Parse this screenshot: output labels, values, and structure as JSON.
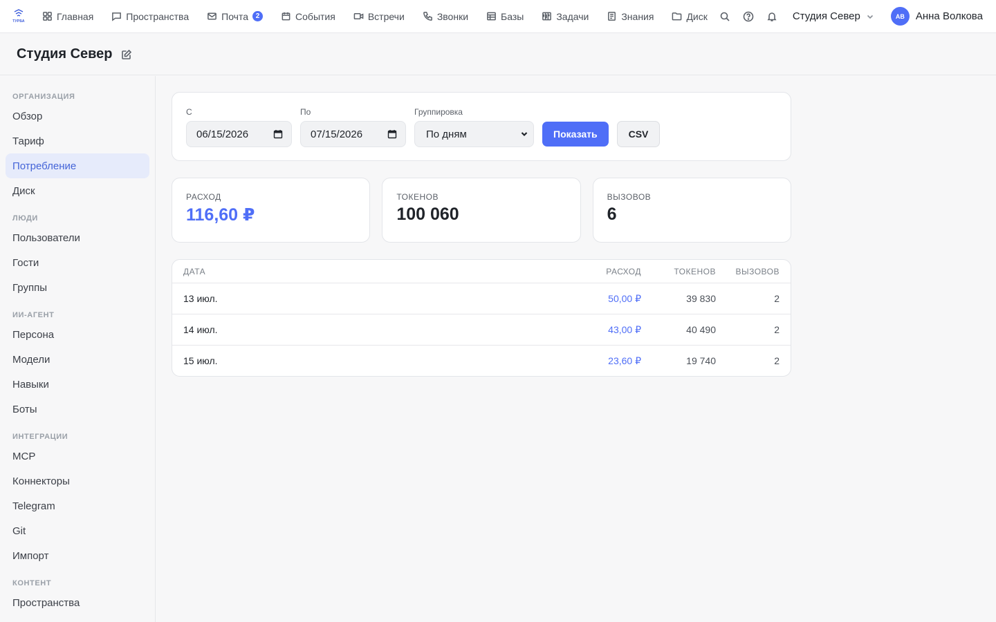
{
  "app": {
    "logo_text": "ТУРБА",
    "nav": [
      {
        "label": "Главная",
        "icon": "grid-icon"
      },
      {
        "label": "Пространства",
        "icon": "chat-icon"
      },
      {
        "label": "Почта",
        "icon": "mail-icon",
        "badge": "2"
      },
      {
        "label": "События",
        "icon": "calendar-icon"
      },
      {
        "label": "Встречи",
        "icon": "video-icon"
      },
      {
        "label": "Звонки",
        "icon": "phone-icon"
      },
      {
        "label": "Базы",
        "icon": "table-icon"
      },
      {
        "label": "Задачи",
        "icon": "kanban-icon"
      },
      {
        "label": "Знания",
        "icon": "book-icon"
      },
      {
        "label": "Диск",
        "icon": "folder-icon"
      }
    ],
    "org_switch": "Студия Север",
    "user": {
      "initials": "АВ",
      "name": "Анна Волкова"
    }
  },
  "page": {
    "title": "Студия Север"
  },
  "sidebar": {
    "sections": [
      {
        "title": "ОРГАНИЗАЦИЯ",
        "items": [
          "Обзор",
          "Тариф",
          "Потребление",
          "Диск"
        ]
      },
      {
        "title": "ЛЮДИ",
        "items": [
          "Пользователи",
          "Гости",
          "Группы"
        ]
      },
      {
        "title": "ИИ-АГЕНТ",
        "items": [
          "Персона",
          "Модели",
          "Навыки",
          "Боты"
        ]
      },
      {
        "title": "ИНТЕГРАЦИИ",
        "items": [
          "MCP",
          "Коннекторы",
          "Telegram",
          "Git",
          "Импорт"
        ]
      },
      {
        "title": "КОНТЕНТ",
        "items": [
          "Пространства"
        ]
      }
    ],
    "active": "Потребление"
  },
  "filters": {
    "from_label": "С",
    "from_value": "06/15/2026",
    "to_label": "По",
    "to_value": "07/15/2026",
    "group_label": "Группировка",
    "group_value": "По дням",
    "show_button": "Показать",
    "csv_button": "CSV"
  },
  "stats": {
    "cost_label": "РАСХОД",
    "cost_value": "116,60 ₽",
    "tokens_label": "ТОКЕНОВ",
    "tokens_value": "100 060",
    "calls_label": "ВЫЗОВОВ",
    "calls_value": "6"
  },
  "table": {
    "headers": {
      "date": "ДАТА",
      "cost": "РАСХОД",
      "tokens": "ТОКЕНОВ",
      "calls": "ВЫЗОВОВ"
    },
    "rows": [
      {
        "date": "13 июл.",
        "cost": "50,00 ₽",
        "tokens": "39 830",
        "calls": "2"
      },
      {
        "date": "14 июл.",
        "cost": "43,00 ₽",
        "tokens": "40 490",
        "calls": "2"
      },
      {
        "date": "15 июл.",
        "cost": "23,60 ₽",
        "tokens": "19 740",
        "calls": "2"
      }
    ]
  },
  "colors": {
    "accent": "#4f6ef7",
    "active_bg": "#e6ebfb"
  }
}
